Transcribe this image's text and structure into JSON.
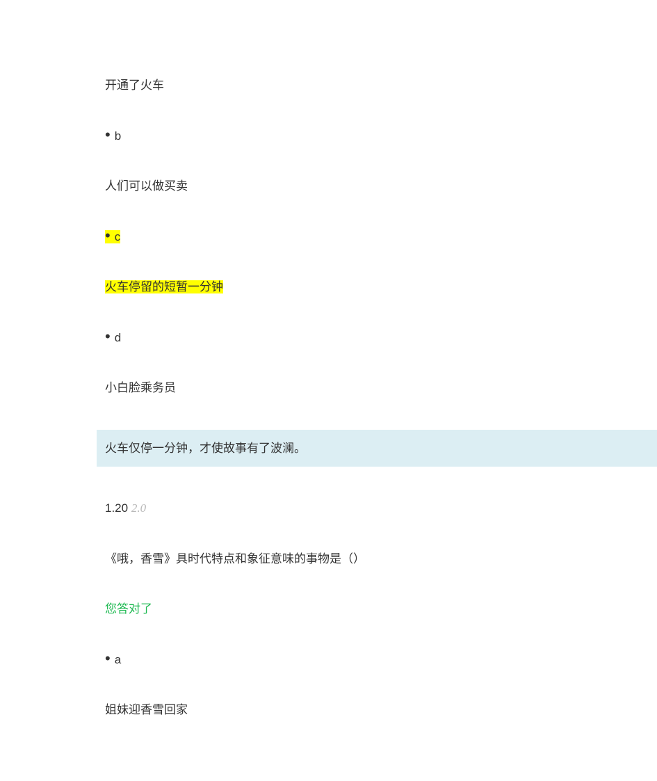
{
  "quiz1": {
    "option_a_text": "开通了火车",
    "option_b_label": "b",
    "option_b_text": "人们可以做买卖",
    "option_c_label": "c",
    "option_c_text": "火车停留的短暂一分钟",
    "option_d_label": "d",
    "option_d_text": "小白脸乘务员",
    "explanation": "火车仅停一分钟，才使故事有了波澜。"
  },
  "quiz2": {
    "score": "1.20",
    "score_max": "2.0",
    "question": "《哦，香雪》具时代特点和象征意味的事物是（）",
    "result": "您答对了",
    "option_a_label": "a",
    "option_a_text": "姐妹迎香雪回家"
  }
}
